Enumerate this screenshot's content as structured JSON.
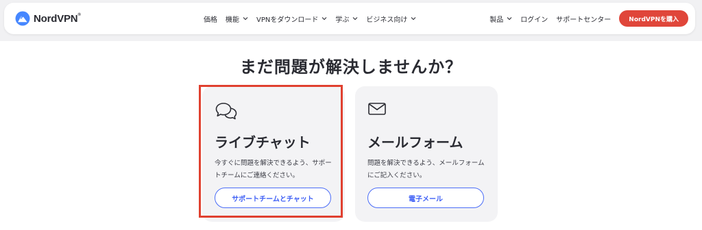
{
  "brand": {
    "name": "NordVPN",
    "trademark": "®",
    "logo_color": "#4687ff"
  },
  "nav": {
    "items": [
      {
        "label": "価格",
        "has_dropdown": false
      },
      {
        "label": "機能",
        "has_dropdown": true
      },
      {
        "label": "VPNをダウンロード",
        "has_dropdown": true
      },
      {
        "label": "学ぶ",
        "has_dropdown": true
      },
      {
        "label": "ビジネス向け",
        "has_dropdown": true
      }
    ],
    "right": {
      "products_label": "製品",
      "login_label": "ログイン",
      "support_label": "サポートセンター",
      "buy_label": "NordVPNを購入",
      "buy_color": "#e0463a"
    }
  },
  "main": {
    "heading": "まだ問題が解決しませんか？",
    "cards": [
      {
        "icon": "chat-bubbles-icon",
        "title": "ライブチャット",
        "description": "今すぐに問題を解決できるよう、サポートチームにご連絡ください。",
        "button_label": "サポートチームとチャット",
        "highlighted": true
      },
      {
        "icon": "mail-icon",
        "title": "メールフォーム",
        "description": "問題を解決できるよう、メールフォームにご記入ください。",
        "button_label": "電子メール",
        "highlighted": false
      }
    ],
    "accent_color": "#4a6cf7",
    "highlight_color": "#e0402f"
  }
}
